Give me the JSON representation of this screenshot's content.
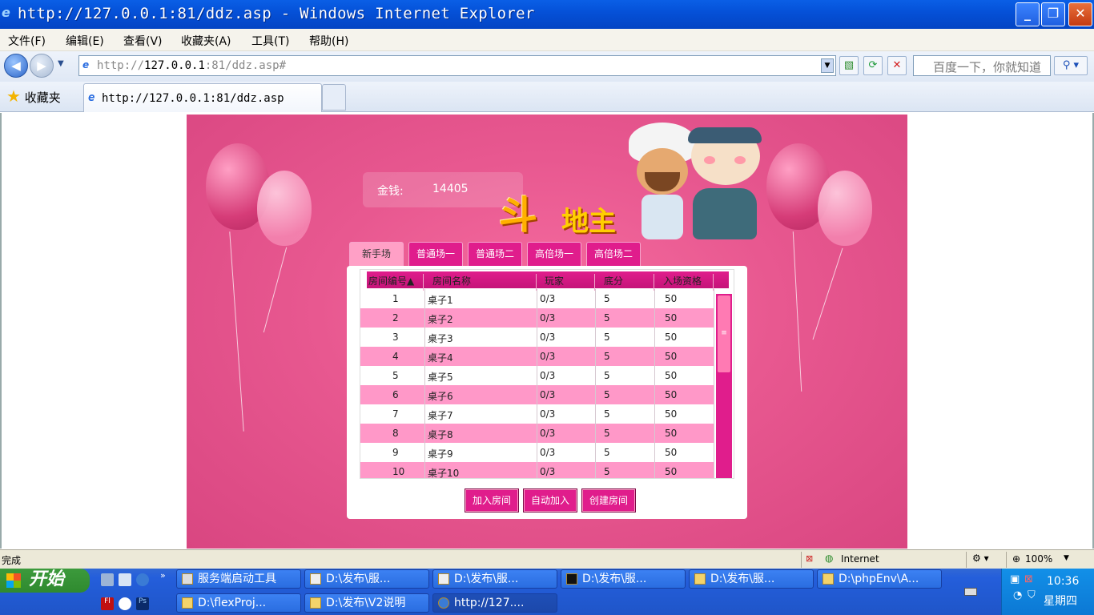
{
  "window": {
    "title": "http://127.0.0.1:81/ddz.asp - Windows Internet Explorer",
    "buttons": [
      "_",
      "❐",
      "✕"
    ]
  },
  "menu": [
    "文件(F)",
    "编辑(E)",
    "查看(V)",
    "收藏夹(A)",
    "工具(T)",
    "帮助(H)"
  ],
  "address": {
    "url_prefix": "http://",
    "url_host": "127.0.0.1",
    "url_rest": ":81/ddz.asp#"
  },
  "search": {
    "placeholder": "百度一下，你就知道"
  },
  "favorites": {
    "label": "收藏夹"
  },
  "tab": {
    "title": "http://127.0.0.1:81/ddz.asp"
  },
  "game": {
    "money_label": "金钱:",
    "money_value": "14405",
    "logo_text_big": "斗",
    "logo_text_small": "地主",
    "room_tabs": [
      "新手场",
      "普通场一",
      "普通场二",
      "高倍场一",
      "高倍场二"
    ],
    "active_tab": 0,
    "columns": [
      "房间编号▲",
      "房间名称",
      "玩家",
      "底分",
      "入场资格"
    ],
    "rows": [
      [
        "1",
        "桌子1",
        "0/3",
        "5",
        "50"
      ],
      [
        "2",
        "桌子2",
        "0/3",
        "5",
        "50"
      ],
      [
        "3",
        "桌子3",
        "0/3",
        "5",
        "50"
      ],
      [
        "4",
        "桌子4",
        "0/3",
        "5",
        "50"
      ],
      [
        "5",
        "桌子5",
        "0/3",
        "5",
        "50"
      ],
      [
        "6",
        "桌子6",
        "0/3",
        "5",
        "50"
      ],
      [
        "7",
        "桌子7",
        "0/3",
        "5",
        "50"
      ],
      [
        "8",
        "桌子8",
        "0/3",
        "5",
        "50"
      ],
      [
        "9",
        "桌子9",
        "0/3",
        "5",
        "50"
      ],
      [
        "10",
        "桌子10",
        "0/3",
        "5",
        "50"
      ]
    ],
    "actions": [
      "加入房间",
      "自动加入",
      "创建房间"
    ]
  },
  "status": {
    "text": "完成",
    "zone": "Internet",
    "zoom": "100%"
  },
  "taskbar": {
    "start": "开始",
    "row1": [
      "服务端启动工具",
      "D:\\发布\\服...",
      "D:\\发布\\服...",
      "D:\\发布\\服...",
      "D:\\发布\\服...",
      "D:\\phpEnv\\A..."
    ],
    "row2": [
      "D:\\flexProj...",
      "D:\\发布\\V2说明",
      "http://127...."
    ],
    "clock": "10:36",
    "day": "星期四"
  },
  "colors": {
    "game_bg": "#e85890",
    "accent": "#e01d8c",
    "row_alt": "#ff98c8"
  }
}
